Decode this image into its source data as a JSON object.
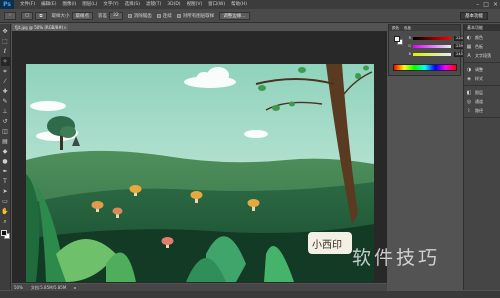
{
  "app": {
    "logo": "Ps"
  },
  "menu": [
    "文件(F)",
    "编辑(E)",
    "图像(I)",
    "图层(L)",
    "文字(Y)",
    "选择(S)",
    "滤镜(T)",
    "3D(D)",
    "视图(V)",
    "窗口(W)",
    "帮助(H)"
  ],
  "window_controls": {
    "minimize": "–",
    "maximize": "□",
    "close": "×"
  },
  "options": {
    "tool_icon": "♢",
    "selection_label": "选区",
    "mode_label": "取样大小",
    "mode_value": "取样点",
    "tolerance_label": "容差",
    "tolerance_value": "32",
    "antialias_label": "消除锯齿",
    "contiguous_label": "连续",
    "all_layers_label": "对所有图层取样",
    "refine_edge": "调整边缘...",
    "workspace": "基本功能"
  },
  "tools": [
    {
      "name": "move-tool",
      "glyph": "✥"
    },
    {
      "name": "marquee-tool",
      "glyph": "⬚"
    },
    {
      "name": "lasso-tool",
      "glyph": "ℓ"
    },
    {
      "name": "magic-wand-tool",
      "glyph": "✧"
    },
    {
      "name": "crop-tool",
      "glyph": "⌗"
    },
    {
      "name": "eyedropper-tool",
      "glyph": "⁄"
    },
    {
      "name": "healing-tool",
      "glyph": "✚"
    },
    {
      "name": "brush-tool",
      "glyph": "✎"
    },
    {
      "name": "stamp-tool",
      "glyph": "⊥"
    },
    {
      "name": "history-brush-tool",
      "glyph": "↺"
    },
    {
      "name": "eraser-tool",
      "glyph": "◫"
    },
    {
      "name": "gradient-tool",
      "glyph": "▤"
    },
    {
      "name": "blur-tool",
      "glyph": "◆"
    },
    {
      "name": "dodge-tool",
      "glyph": "●"
    },
    {
      "name": "pen-tool",
      "glyph": "✒"
    },
    {
      "name": "type-tool",
      "glyph": "T"
    },
    {
      "name": "path-select-tool",
      "glyph": "➤"
    },
    {
      "name": "shape-tool",
      "glyph": "▭"
    },
    {
      "name": "hand-tool",
      "glyph": "✋"
    },
    {
      "name": "zoom-tool",
      "glyph": "⌕"
    }
  ],
  "document": {
    "tab": "fjjt.jpg @ 50% (RGB/8#)",
    "close": "×"
  },
  "status": {
    "zoom": "50%",
    "doc_size": "文档:5.85M/5.85M",
    "arrow": "▸"
  },
  "color_panel": {
    "tabs": [
      "颜色",
      "色板"
    ],
    "sliders": [
      {
        "label": "R",
        "value": "224"
      },
      {
        "label": "G",
        "value": "239"
      },
      {
        "label": "B",
        "value": "245"
      }
    ]
  },
  "dock": {
    "header": "基本功能",
    "groups": [
      [
        {
          "name": "color",
          "icon": "◐",
          "label": "颜色"
        },
        {
          "name": "swatches",
          "icon": "▦",
          "label": "色板"
        },
        {
          "name": "character",
          "icon": "A",
          "label": "文字段落"
        }
      ],
      [
        {
          "name": "adjustments",
          "icon": "◑",
          "label": "调整"
        },
        {
          "name": "styles",
          "icon": "◈",
          "label": "样式"
        }
      ],
      [
        {
          "name": "layers",
          "icon": "◧",
          "label": "图层"
        },
        {
          "name": "channels",
          "icon": "◎",
          "label": "通道"
        },
        {
          "name": "paths",
          "icon": "⌇",
          "label": "路径"
        }
      ]
    ]
  },
  "canvas_signature": "小西印",
  "watermark": "软件技巧"
}
